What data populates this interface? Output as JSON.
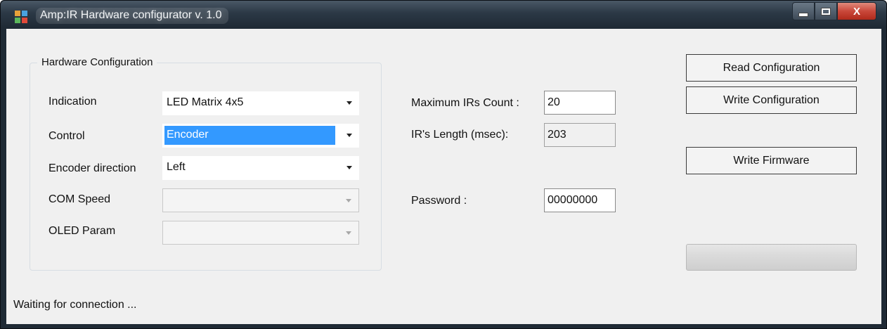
{
  "window": {
    "title": "Amp:IR Hardware configurator v. 1.0",
    "close_glyph": "X"
  },
  "hardware_group": {
    "title": "Hardware Configuration",
    "indication": {
      "label": "Indication",
      "value": "LED Matrix 4x5"
    },
    "control": {
      "label": "Control",
      "value": "Encoder"
    },
    "encoder_direction": {
      "label": "Encoder direction",
      "value": "Left"
    },
    "com_speed": {
      "label": "COM Speed",
      "value": ""
    },
    "oled_param": {
      "label": "OLED Param",
      "value": ""
    }
  },
  "settings": {
    "max_irs": {
      "label": "Maximum IRs Count :",
      "value": "20"
    },
    "ir_length": {
      "label": "IR's Length (msec):",
      "value": "203"
    },
    "password": {
      "label": "Password :",
      "value": "00000000"
    }
  },
  "buttons": {
    "read_config": "Read Configuration",
    "write_config": "Write Configuration",
    "write_firmware": "Write Firmware"
  },
  "progress": {
    "value": 0
  },
  "status": "Waiting for connection ...",
  "colors": {
    "selection": "#3399ff",
    "close_button": "#c9473a",
    "client_bg": "#f0f0f0"
  }
}
